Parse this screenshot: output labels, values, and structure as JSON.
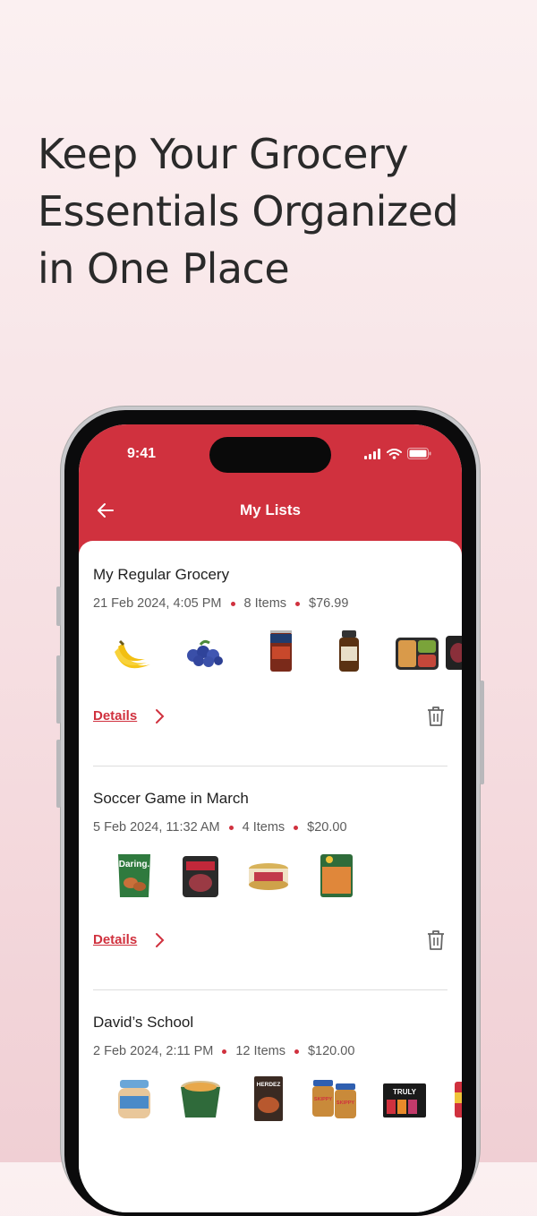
{
  "headline": {
    "line1": "Keep Your Grocery",
    "line2": "Essentials Organized",
    "line3": "in One Place"
  },
  "status_bar": {
    "time": "9:41"
  },
  "header": {
    "title": "My Lists"
  },
  "lists": [
    {
      "title": "My Regular Grocery",
      "date": "21 Feb 2024, 4:05 PM",
      "items": "8 Items",
      "price": "$76.99",
      "details_label": "Details",
      "products": [
        "bananas",
        "blueberries",
        "canned-beans",
        "supplement-jar",
        "meal-container",
        "meat-pack"
      ]
    },
    {
      "title": "Soccer Game in March",
      "date": "5 Feb 2024, 11:32 AM",
      "items": "4 Items",
      "price": "$20.00",
      "details_label": "Details",
      "products": [
        "daring-pouch",
        "sausage-pack",
        "cat-food-can",
        "soup-pouch"
      ],
      "product_brand": "Daring."
    },
    {
      "title": "David’s School",
      "date": "2 Feb 2024, 2:11 PM",
      "items": "12 Items",
      "price": "$120.00",
      "details_label": "Details",
      "products": [
        "baby-food-jar",
        "noodle-cup",
        "dinner-box",
        "peanut-butter-jars",
        "truly-box",
        "can"
      ],
      "product_brands": [
        "HERDEZ",
        "SKIPPY",
        "SKIPPY",
        "TRULY"
      ]
    }
  ],
  "colors": {
    "accent": "#d0313e",
    "background": "#f6dfe2"
  }
}
